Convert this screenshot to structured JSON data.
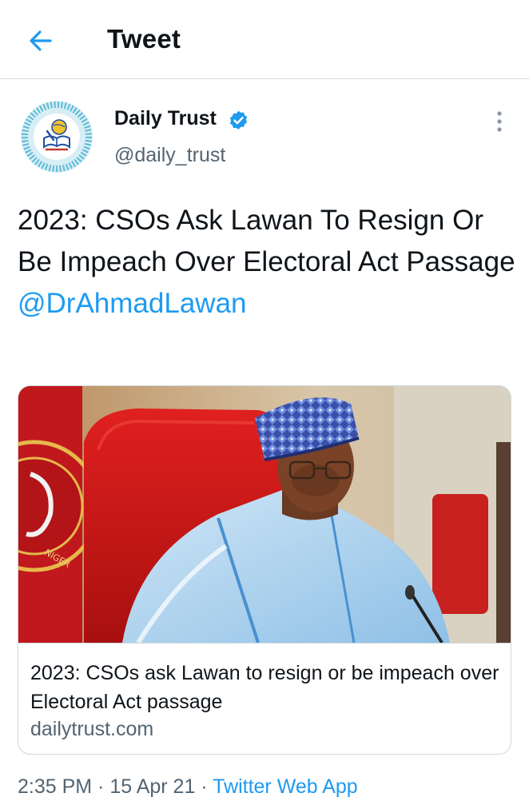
{
  "header": {
    "title": "Tweet",
    "back_icon": "arrow-left-icon"
  },
  "author": {
    "name": "Daily Trust",
    "handle": "@daily_trust",
    "verified": true,
    "avatar_icon": "daily-trust-logo"
  },
  "tweet": {
    "text": "2023: CSOs Ask Lawan To Resign Or Be Impeach Over Electoral Act Passage",
    "mention": "@DrAhmadLawan"
  },
  "card": {
    "title": "2023: CSOs ask Lawan to resign or be impeach over Electoral Act passage",
    "domain": "dailytrust.com",
    "image_emblem_text": "NIGER"
  },
  "meta": {
    "time": "2:35 PM",
    "separator": " · ",
    "date": "15 Apr 21",
    "source": "Twitter Web App"
  },
  "colors": {
    "accent": "#1d9bf0",
    "text": "#0f1419",
    "secondary": "#536471",
    "border": "#cfd9de"
  }
}
